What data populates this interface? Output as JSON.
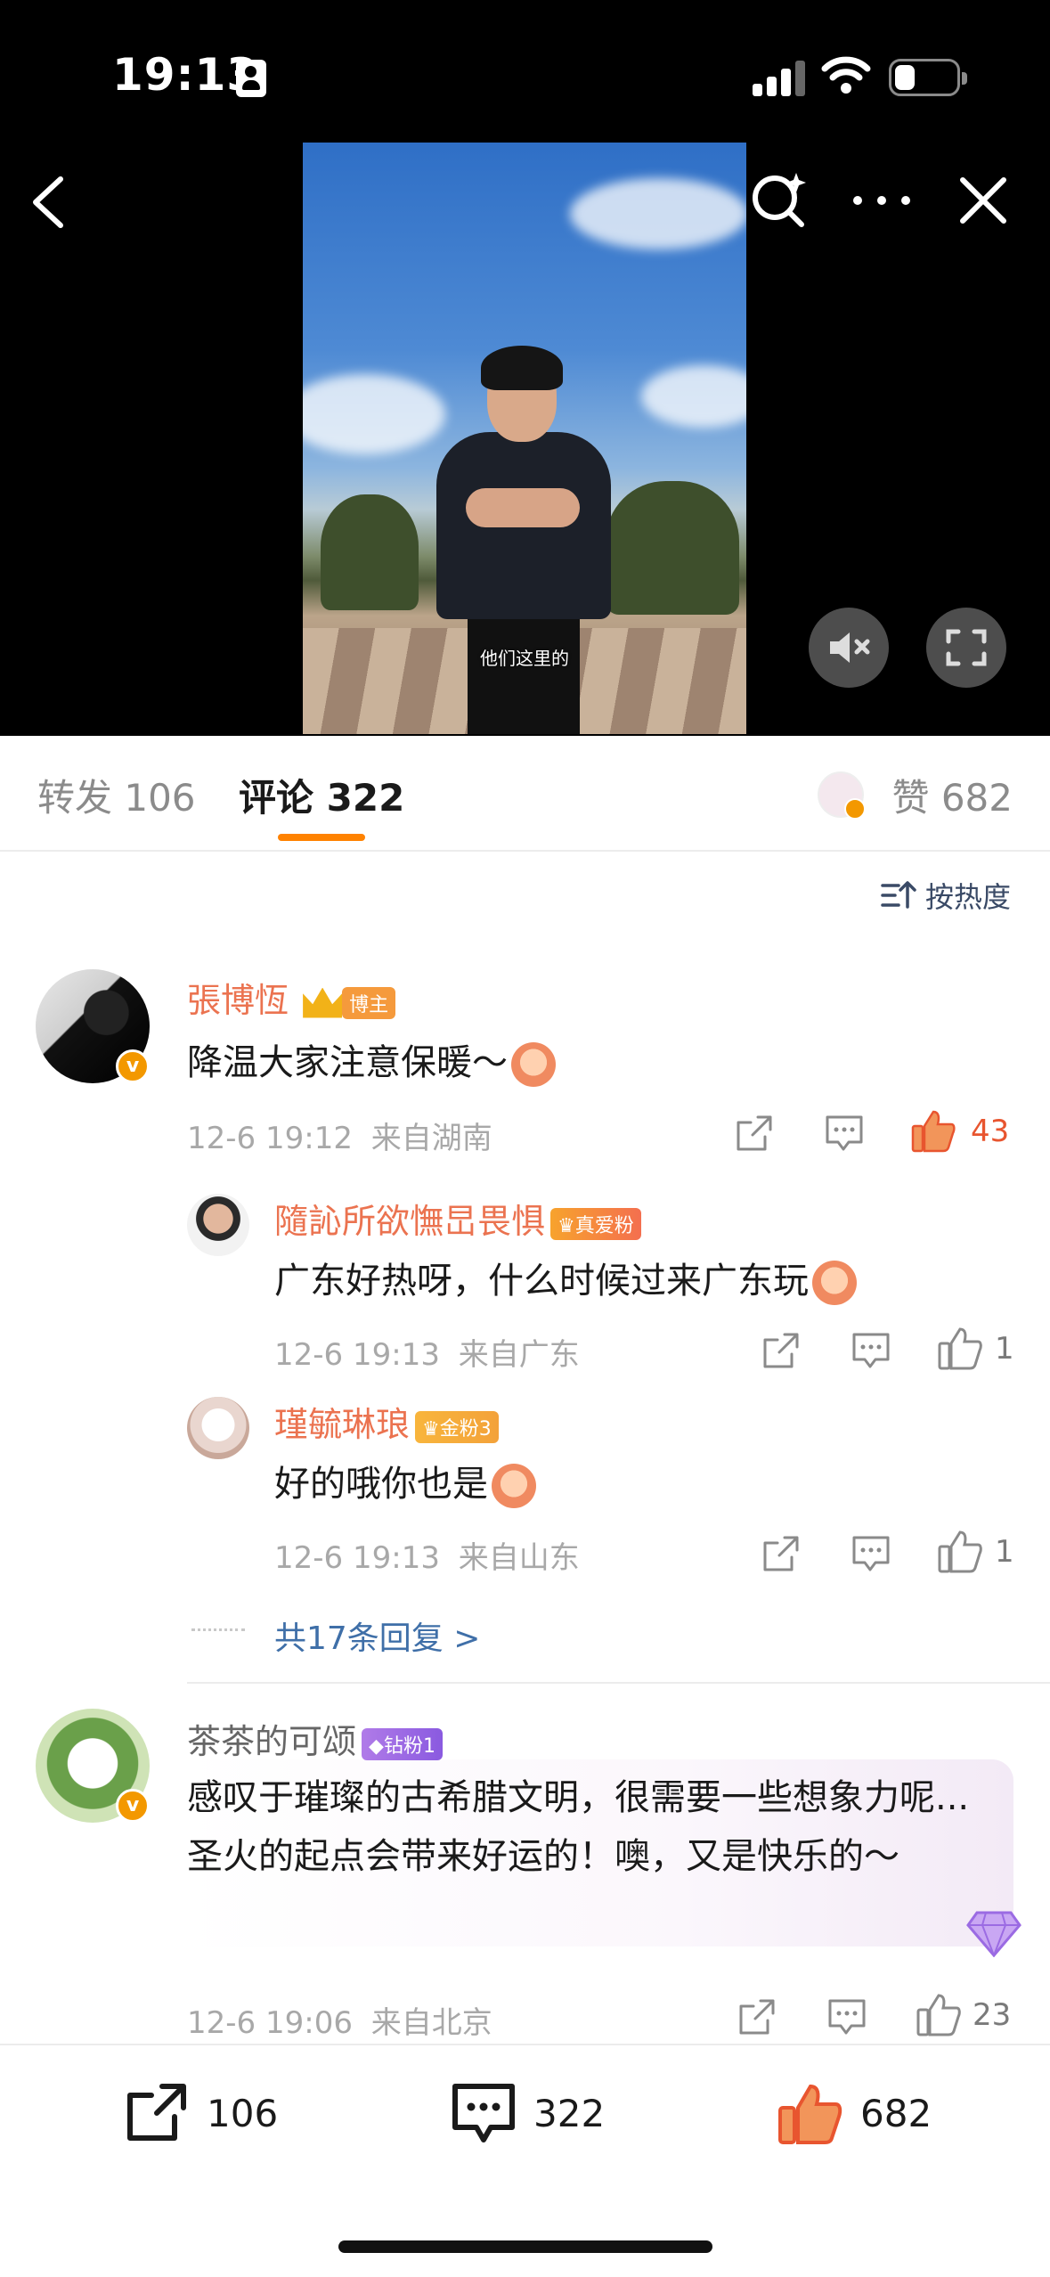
{
  "status_bar": {
    "time": "19:13"
  },
  "video": {
    "subtitle": "他们这里的"
  },
  "tabs": {
    "repost_label": "转发 106",
    "comment_label": "评论 322",
    "like_label": "赞 682"
  },
  "sort": {
    "label": "按热度"
  },
  "comments": [
    {
      "name": "張博恆",
      "badge": "博主",
      "text": "降温大家注意保暖～",
      "time": "12-6 19:12",
      "location": "来自湖南",
      "likes": "43",
      "replies": [
        {
          "name": "隨訫所欲憮旵畏惧",
          "badge": "真爱粉",
          "text": "广东好热呀，什么时候过来广东玩",
          "time": "12-6 19:13",
          "location": "来自广东",
          "likes": "1"
        },
        {
          "name": "瑾毓琳琅",
          "badge": "金粉3",
          "text": "好的哦你也是",
          "time": "12-6 19:13",
          "location": "来自山东",
          "likes": "1"
        }
      ],
      "more_replies": "共17条回复 >"
    },
    {
      "name": "茶茶的可颂",
      "badge": "钻粉1",
      "text": "感叹于璀璨的古希腊文明，很需要一些想象力呢...圣火的起点会带来好运的！噢，又是快乐的～",
      "time": "12-6 19:06",
      "location": "来自北京",
      "likes": "23"
    }
  ],
  "bottom_bar": {
    "repost_count": "106",
    "comment_count": "322",
    "like_count": "682"
  },
  "colors": {
    "accent": "#ff8200",
    "name_orange": "#eb7350",
    "link_blue": "#3f6fa8",
    "verify_orange": "#f39800"
  }
}
